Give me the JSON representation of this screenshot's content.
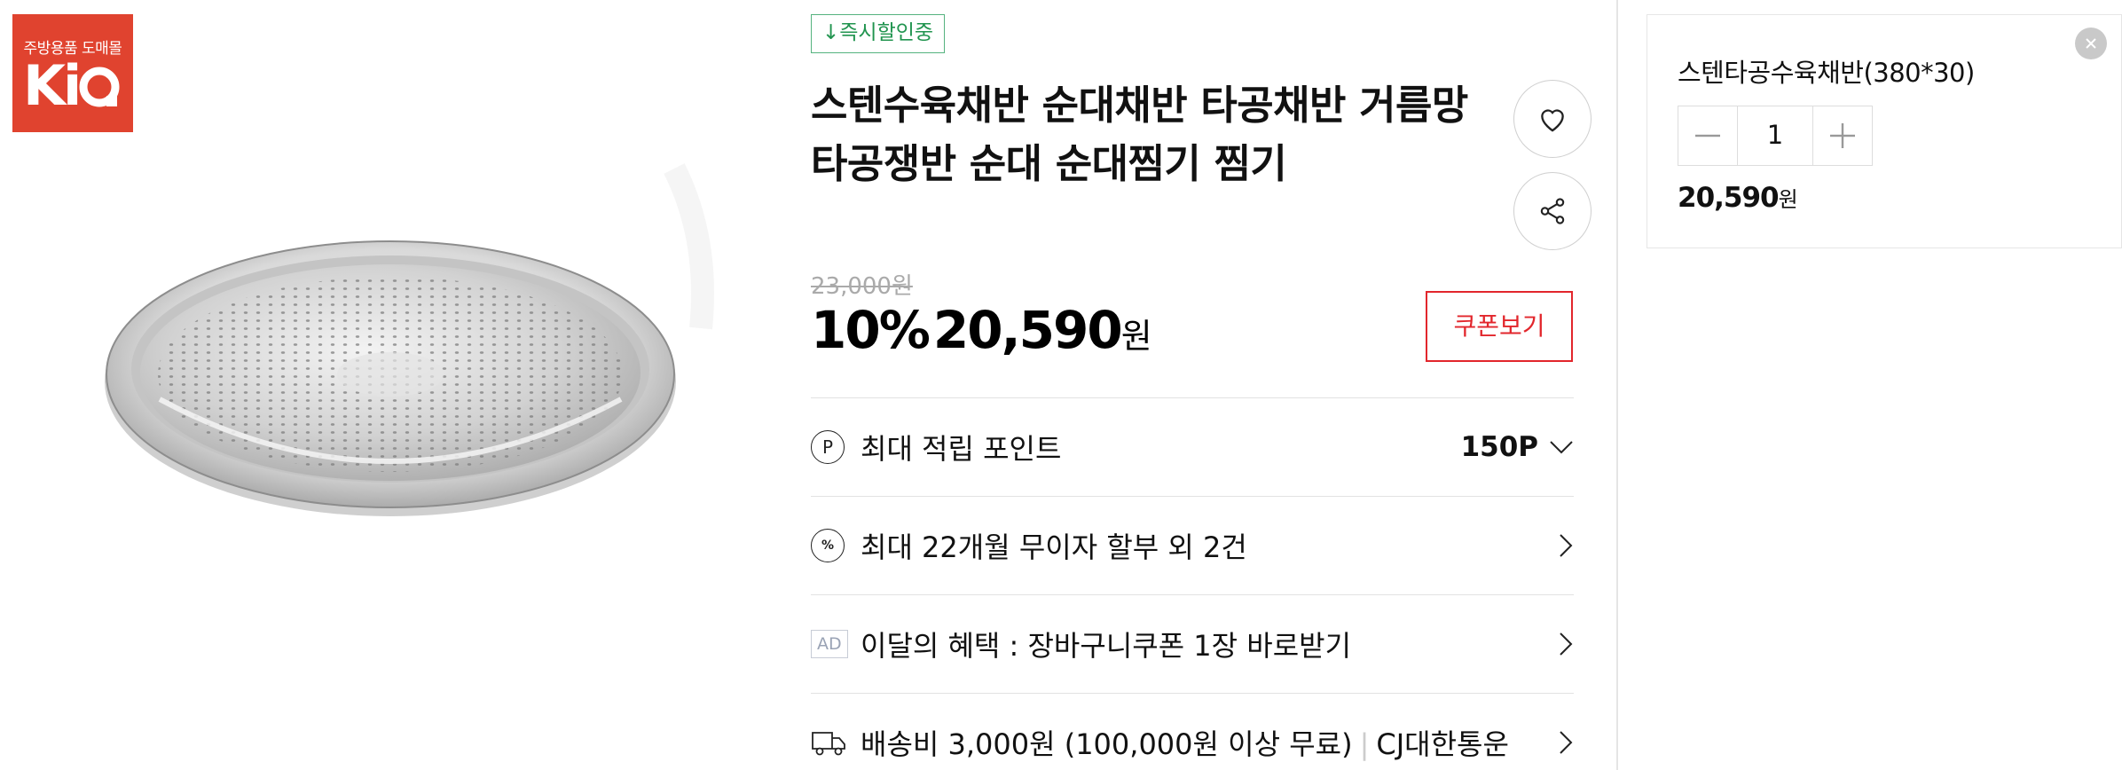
{
  "logo": {
    "top_text": "주방용품 도매몰",
    "brand": "KIA"
  },
  "product": {
    "badge": "↓즉시할인중",
    "title": "스텐수육채반 순대채반 타공채반 거름망 타공쟁반 순대 순대찜기 찜기",
    "original_price": "23,000원",
    "discount": "10%",
    "price": "20,590",
    "price_unit": "원",
    "coupon_button": "쿠폰보기"
  },
  "benefits": [
    {
      "icon": "point-icon",
      "glyph": "P",
      "text": "최대 적립 포인트",
      "value": "150P"
    },
    {
      "icon": "percent-icon",
      "glyph": "%",
      "text": "최대 22개월 무이자 할부 외 2건"
    },
    {
      "icon": "ad-label",
      "glyph": "AD",
      "text": "이달의 혜택 : 장바구니쿠폰 1장 바로받기"
    },
    {
      "icon": "truck-icon",
      "text": "배송비 3,000원 (100,000원 이상 무료)",
      "carrier": "CJ대한통운"
    }
  ],
  "selected_option": {
    "name": "스텐타공수육채반(380*30)",
    "quantity": "1",
    "price": "20,590",
    "price_unit": "원"
  },
  "colors": {
    "brand_red": "#e0432f",
    "coupon_red": "#e2262c",
    "badge_green": "#21944f"
  }
}
